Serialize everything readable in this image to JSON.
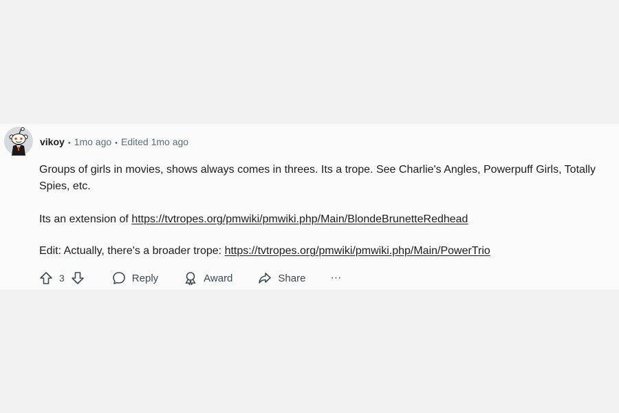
{
  "comment": {
    "author": "vikoy",
    "time": "1mo ago",
    "edited": "Edited 1mo ago",
    "separator": "•",
    "paragraphs": {
      "p1": "Groups of girls in movies, shows always comes in threes. Its a trope. See Charlie's Angles, Powerpuff Girls, Totally Spies, etc.",
      "p2_prefix": "Its an extension of ",
      "p2_link": "https://tvtropes.org/pmwiki/pmwiki.php/Main/BlondeBrunetteRedhead",
      "p3_prefix": "Edit: Actually, there's a broader trope: ",
      "p3_link": "https://tvtropes.org/pmwiki/pmwiki.php/Main/PowerTrio"
    }
  },
  "actions": {
    "vote_count": "3",
    "reply_label": "Reply",
    "award_label": "Award",
    "share_label": "Share",
    "more_label": "···",
    "upvote_icon": "arrow-up-icon",
    "downvote_icon": "arrow-down-icon",
    "reply_icon": "speech-bubble-icon",
    "award_icon": "award-ribbon-icon",
    "share_icon": "share-arrow-icon"
  },
  "colors": {
    "page_bg": "#f2f2f3",
    "comment_bg": "#fafafa",
    "meta_text": "#576f76",
    "body_text": "#1c1c1c"
  }
}
